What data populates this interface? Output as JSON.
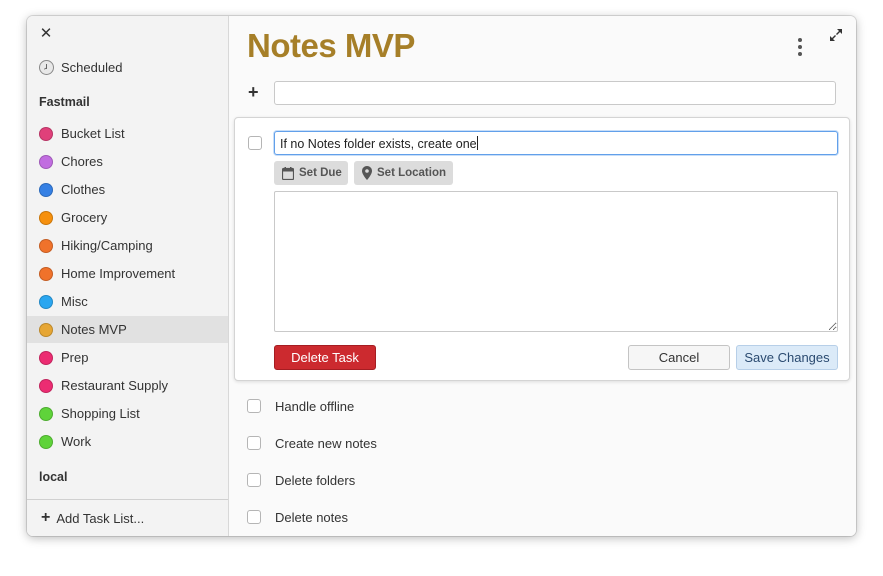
{
  "sidebar": {
    "scheduled_label": "Scheduled",
    "section_fastmail": "Fastmail",
    "section_local": "local",
    "add_list_label": "Add Task List...",
    "lists": [
      {
        "label": "Bucket List",
        "color": "#e0407a"
      },
      {
        "label": "Chores",
        "color": "#c16de0"
      },
      {
        "label": "Clothes",
        "color": "#3580e4"
      },
      {
        "label": "Grocery",
        "color": "#f6900d"
      },
      {
        "label": "Hiking/Camping",
        "color": "#f0722b"
      },
      {
        "label": "Home Improvement",
        "color": "#f0722b"
      },
      {
        "label": "Misc",
        "color": "#2aa6f0"
      },
      {
        "label": "Notes MVP",
        "color": "#e6a634"
      },
      {
        "label": "Prep",
        "color": "#ec2c72"
      },
      {
        "label": "Restaurant Supply",
        "color": "#ec2c72"
      },
      {
        "label": "Shopping List",
        "color": "#5fd33a"
      },
      {
        "label": "Work",
        "color": "#5fd33a"
      }
    ],
    "selected": "Notes MVP"
  },
  "main": {
    "title": "Notes MVP",
    "title_color": "#a67f28",
    "new_task_placeholder": "",
    "editor": {
      "task_text": "If no Notes folder exists, create one",
      "set_due_label": "Set Due",
      "set_location_label": "Set Location",
      "notes_value": "",
      "delete_label": "Delete Task",
      "cancel_label": "Cancel",
      "save_label": "Save Changes"
    },
    "tasks": [
      {
        "label": "Handle offline"
      },
      {
        "label": "Create new notes"
      },
      {
        "label": "Delete folders"
      },
      {
        "label": "Delete notes"
      }
    ]
  }
}
